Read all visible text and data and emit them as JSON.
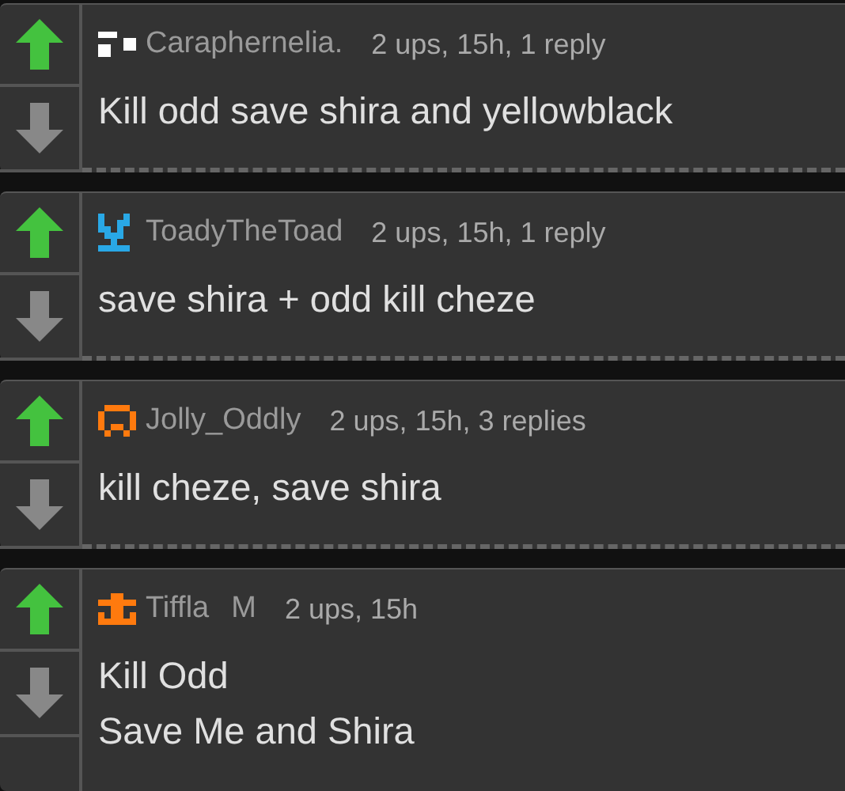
{
  "comments": [
    {
      "username": "Caraphernelia.",
      "avatar": {
        "kind": "dots",
        "color": "#ffffff"
      },
      "meta": "2 ups, 15h, 1 reply",
      "upvoted": true,
      "text": "Kill odd save shira and yellowblack"
    },
    {
      "username": "ToadyTheToad",
      "avatar": {
        "kind": "tower",
        "color": "#29a8e6"
      },
      "meta": "2 ups, 15h, 1 reply",
      "upvoted": true,
      "text": "save shira + odd kill cheze"
    },
    {
      "username": "Jolly_Oddly",
      "avatar": {
        "kind": "face",
        "color": "#ff7a0e"
      },
      "meta": "2 ups, 15h, 3 replies",
      "upvoted": true,
      "text": "kill cheze, save shira"
    },
    {
      "username": "Tiffla",
      "flair": "M",
      "avatar": {
        "kind": "anchor",
        "color": "#ff7a0e"
      },
      "meta": "2 ups, 15h",
      "upvoted": true,
      "text": "Kill Odd\nSave Me and Shira"
    }
  ]
}
